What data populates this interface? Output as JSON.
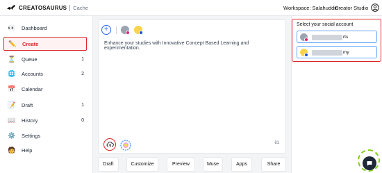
{
  "header": {
    "brand": "CREATOSAURUS",
    "app": "Cache",
    "workspace_label": "Workspace: Salahuddin",
    "studio_label": "Creator Studio"
  },
  "sidebar": {
    "items": [
      {
        "label": "Dashboard",
        "count": "",
        "icon": "eyes-icon"
      },
      {
        "label": "Create",
        "count": "",
        "icon": "pencil-icon",
        "active": true
      },
      {
        "label": "Queue",
        "count": "1",
        "icon": "hourglass-icon"
      },
      {
        "label": "Accounts",
        "count": "2",
        "icon": "globe-icon"
      },
      {
        "label": "Calendar",
        "count": "",
        "icon": "calendar-icon"
      },
      {
        "label": "Draft",
        "count": "1",
        "icon": "notepad-icon"
      },
      {
        "label": "History",
        "count": "0",
        "icon": "book-icon"
      },
      {
        "label": "Settings",
        "count": "",
        "icon": "gear-icon"
      },
      {
        "label": "Help",
        "count": "",
        "icon": "person-icon"
      }
    ]
  },
  "composer": {
    "post_text": "Enhance your studies with Innovative Concept Based Learning and experimentation.",
    "char_count": "81"
  },
  "actions": [
    "Draft",
    "Customize",
    "Preview",
    "Muse",
    "Apps",
    "Share"
  ],
  "social_panel": {
    "title": "Select your social account",
    "accounts": [
      {
        "suffix": "rts",
        "network": "instagram",
        "badge_color": "#db2777"
      },
      {
        "suffix": "my",
        "network": "facebook",
        "badge_color": "#1d4ed8"
      }
    ]
  },
  "colors": {
    "accent_red": "#dc2626",
    "accent_blue": "#2563eb",
    "chat_green": "#84cc16"
  }
}
